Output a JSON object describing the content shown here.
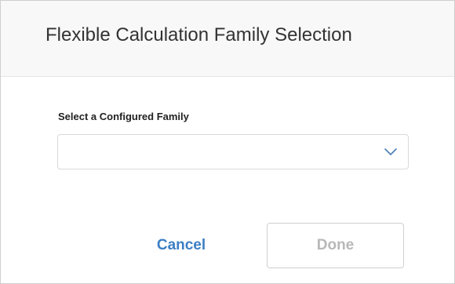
{
  "dialog": {
    "title": "Flexible Calculation Family Selection",
    "field": {
      "label": "Select a Configured Family",
      "selected_value": "",
      "icon": "chevron-down-icon"
    },
    "buttons": {
      "cancel_label": "Cancel",
      "done_label": "Done",
      "done_enabled": false
    }
  },
  "colors": {
    "accent": "#3d7fc4",
    "disabled_text": "#b8b8b8",
    "header_background": "#f8f8f8"
  }
}
